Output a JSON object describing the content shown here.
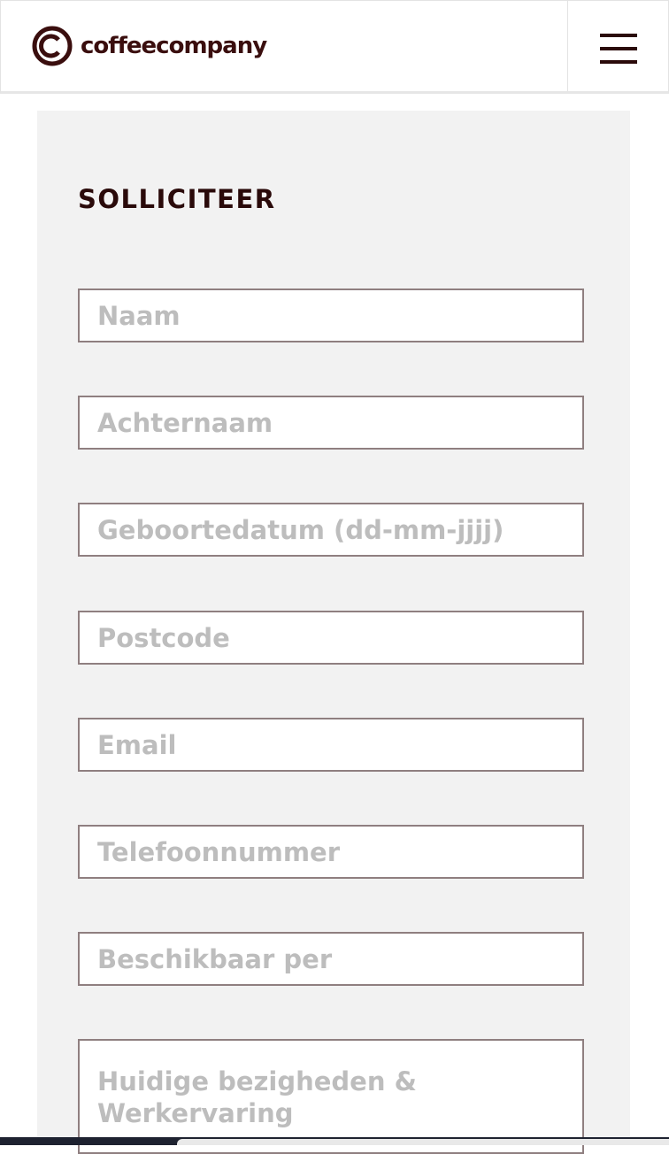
{
  "header": {
    "brand": "coffeecompany",
    "logo_icon": "coffeecompany-logo-icon",
    "menu_icon": "hamburger-menu-icon",
    "brand_color": "#3a0e0e"
  },
  "form": {
    "title": "SOLLICITEER",
    "fields": [
      {
        "name": "first-name",
        "placeholder": "Naam",
        "value": ""
      },
      {
        "name": "last-name",
        "placeholder": "Achternaam",
        "value": ""
      },
      {
        "name": "birthdate",
        "placeholder": "Geboortedatum (dd-mm-jjjj)",
        "value": ""
      },
      {
        "name": "postcode",
        "placeholder": "Postcode",
        "value": ""
      },
      {
        "name": "email",
        "placeholder": "Email",
        "value": ""
      },
      {
        "name": "phone",
        "placeholder": "Telefoonnummer",
        "value": ""
      },
      {
        "name": "available-from",
        "placeholder": "Beschikbaar per",
        "value": ""
      },
      {
        "name": "current-activities",
        "placeholder": "Huidige bezigheden & Werkervaring",
        "value": ""
      }
    ]
  },
  "colors": {
    "panel_bg": "#f2f2f2",
    "field_border": "#8f7f80",
    "placeholder": "#bdbdbd",
    "title": "#2a0a0a"
  }
}
